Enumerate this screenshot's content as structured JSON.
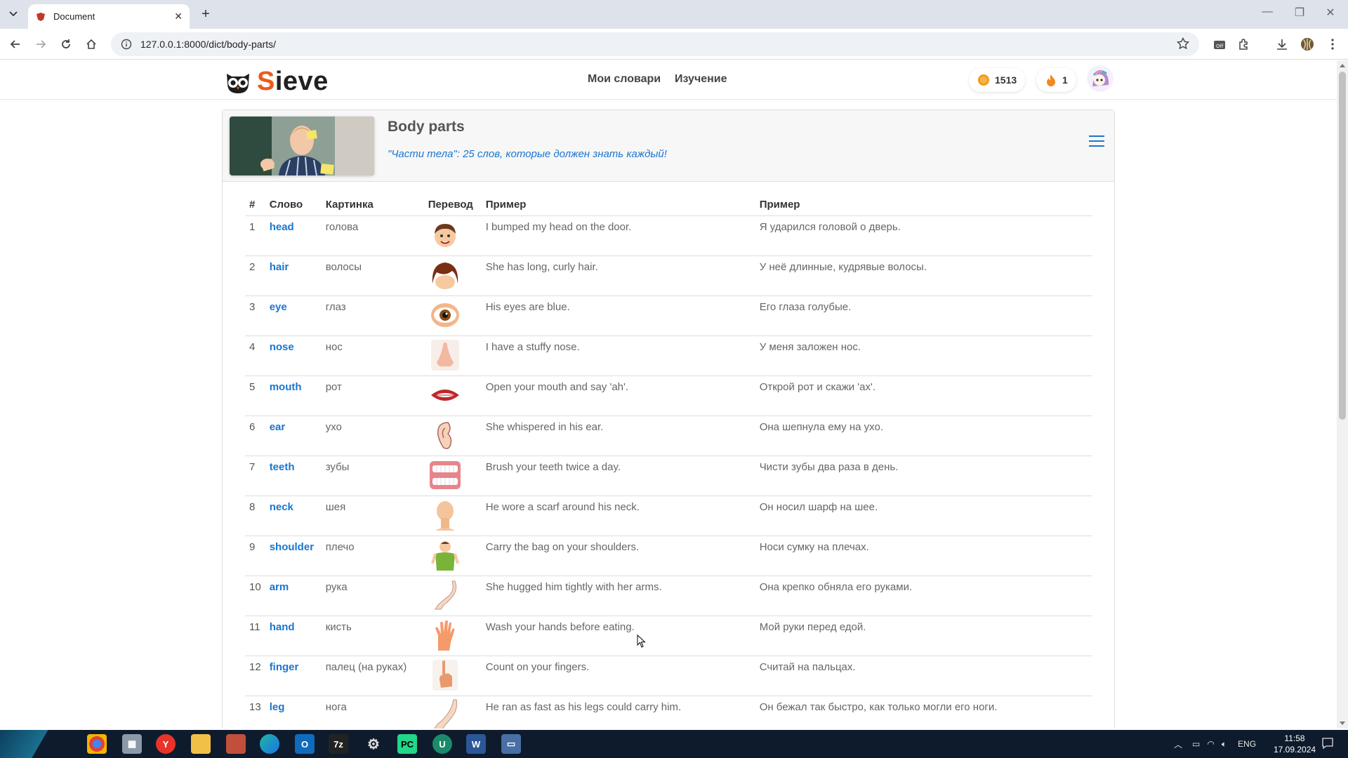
{
  "browser": {
    "tab_title": "Document",
    "url": "127.0.0.1:8000/dict/body-parts/"
  },
  "site": {
    "brand_first": "S",
    "brand_rest": "ieve",
    "nav": [
      "Мои словари",
      "Изучение"
    ],
    "coins": "1513",
    "streak": "1"
  },
  "dictionary": {
    "title": "Body parts",
    "subtitle": "\"Части тела\": 25 слов, которые должен знать каждый!",
    "columns": [
      "#",
      "Слово",
      "Картинка",
      "Перевод",
      "Пример",
      "Пример"
    ],
    "rows": [
      {
        "n": "1",
        "word": "head",
        "translation": "голова",
        "icon": "head-icon",
        "example_en": "I bumped my head on the door.",
        "example_ru": "Я ударился головой о дверь."
      },
      {
        "n": "2",
        "word": "hair",
        "translation": "волосы",
        "icon": "hair-icon",
        "example_en": "She has long, curly hair.",
        "example_ru": "У неё длинные, кудрявые волосы."
      },
      {
        "n": "3",
        "word": "eye",
        "translation": "глаз",
        "icon": "eye-icon",
        "example_en": "His eyes are blue.",
        "example_ru": "Его глаза голубые."
      },
      {
        "n": "4",
        "word": "nose",
        "translation": "нос",
        "icon": "nose-icon",
        "example_en": "I have a stuffy nose.",
        "example_ru": "У меня заложен нос."
      },
      {
        "n": "5",
        "word": "mouth",
        "translation": "рот",
        "icon": "mouth-icon",
        "example_en": "Open your mouth and say 'ah'.",
        "example_ru": "Открой рот и скажи 'ах'."
      },
      {
        "n": "6",
        "word": "ear",
        "translation": "ухо",
        "icon": "ear-icon",
        "example_en": "She whispered in his ear.",
        "example_ru": "Она шепнула ему на ухо."
      },
      {
        "n": "7",
        "word": "teeth",
        "translation": "зубы",
        "icon": "teeth-icon",
        "example_en": "Brush your teeth twice a day.",
        "example_ru": "Чисти зубы два раза в день."
      },
      {
        "n": "8",
        "word": "neck",
        "translation": "шея",
        "icon": "neck-icon",
        "example_en": "He wore a scarf around his neck.",
        "example_ru": "Он носил шарф на шее."
      },
      {
        "n": "9",
        "word": "shoulder",
        "translation": "плечо",
        "icon": "shoulder-icon",
        "example_en": "Carry the bag on your shoulders.",
        "example_ru": "Носи сумку на плечах."
      },
      {
        "n": "10",
        "word": "arm",
        "translation": "рука",
        "icon": "arm-icon",
        "example_en": "She hugged him tightly with her arms.",
        "example_ru": "Она крепко обняла его руками."
      },
      {
        "n": "11",
        "word": "hand",
        "translation": "кисть",
        "icon": "hand-icon",
        "example_en": "Wash your hands before eating.",
        "example_ru": "Мой руки перед едой."
      },
      {
        "n": "12",
        "word": "finger",
        "translation": "палец (на руках)",
        "icon": "finger-icon",
        "example_en": "Count on your fingers.",
        "example_ru": "Считай на пальцах."
      },
      {
        "n": "13",
        "word": "leg",
        "translation": "нога",
        "icon": "leg-icon",
        "example_en": "He ran as fast as his legs could carry him.",
        "example_ru": "Он бежал так быстро, как только могли его ноги."
      }
    ]
  },
  "taskbar": {
    "lang": "ENG",
    "time": "11:58",
    "date": "17.09.2024"
  },
  "colors": {
    "brand_orange": "#ec5a1c",
    "link_blue": "#1976d2"
  }
}
